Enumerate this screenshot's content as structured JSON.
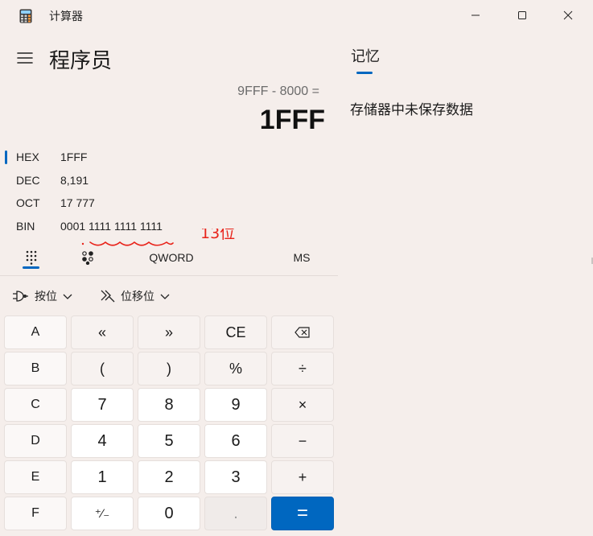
{
  "window": {
    "title": "计算器",
    "icons": [
      "calculator-app-icon",
      "minimize-icon",
      "maximize-icon",
      "close-icon"
    ]
  },
  "header": {
    "mode_title": "程序员",
    "menu_icon": "hamburger-menu-icon"
  },
  "display": {
    "expression": "9FFF - 8000 =",
    "result": "1FFF"
  },
  "radix": {
    "selected": "HEX",
    "rows": [
      {
        "name": "HEX",
        "value": "1FFF"
      },
      {
        "name": "DEC",
        "value": "8,191"
      },
      {
        "name": "OCT",
        "value": "17 777"
      },
      {
        "name": "BIN",
        "value": "0001 1111 1111 1111"
      }
    ]
  },
  "keypad_modes": {
    "full_keypad_icon": "full-keypad-icon",
    "bit_toggle_icon": "bit-toggle-keypad-icon",
    "word_size": "QWORD",
    "memory_store": "MS"
  },
  "dropdowns": {
    "bitwise": "按位",
    "bitshift": "位移位"
  },
  "keys": [
    [
      "A",
      "«",
      "»",
      "CE",
      "⌫"
    ],
    [
      "B",
      "(",
      ")",
      "%",
      "÷"
    ],
    [
      "C",
      "7",
      "8",
      "9",
      "×"
    ],
    [
      "D",
      "4",
      "5",
      "6",
      "−"
    ],
    [
      "E",
      "1",
      "2",
      "3",
      "+"
    ],
    [
      "F",
      "⁺∕₋",
      "0",
      ".",
      "="
    ]
  ],
  "memory": {
    "tab_label": "记忆",
    "empty_message": "存储器中未保存数据"
  },
  "annotation": {
    "text": "13位",
    "color": "#e8231a"
  },
  "colors": {
    "accent": "#0067c0",
    "background": "#f5eeeb"
  }
}
